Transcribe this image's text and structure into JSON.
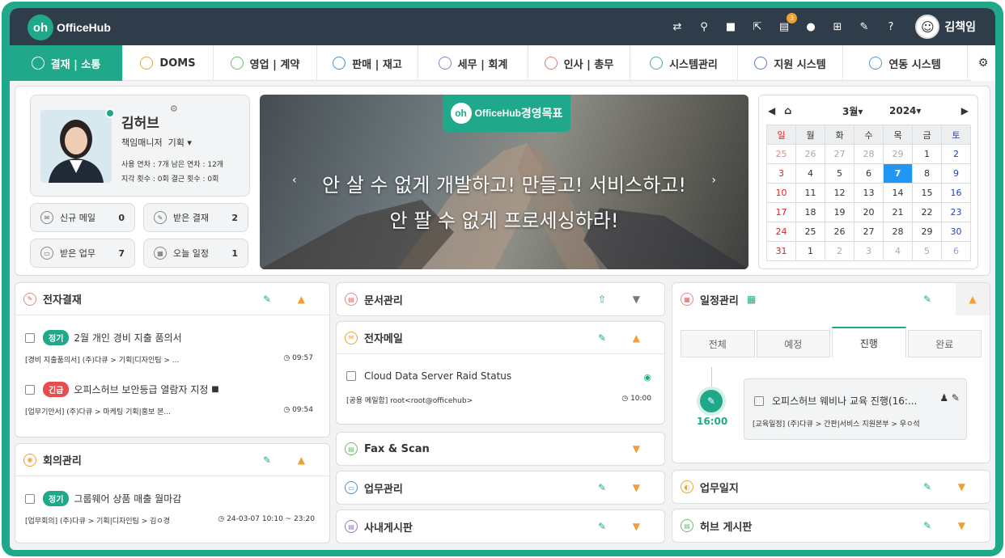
{
  "app": {
    "logo": "OfficeHub",
    "user": "김책임",
    "notif_badge": "3"
  },
  "nav": {
    "items": [
      {
        "label": "결재 | 소통",
        "icon": "chat-icon",
        "active": true,
        "w": 140
      },
      {
        "label": "DOMS",
        "icon": "doms-icon",
        "w": 112
      },
      {
        "label": "영업 | 계약",
        "icon": "handshake-icon",
        "w": 128
      },
      {
        "label": "판매 | 재고",
        "icon": "cart-icon",
        "w": 125
      },
      {
        "label": "세무 | 회계",
        "icon": "won-icon",
        "w": 136
      },
      {
        "label": "인사 | 총무",
        "icon": "person-icon",
        "w": 126
      },
      {
        "label": "시스템관리",
        "icon": "monitor-icon",
        "w": 133
      },
      {
        "label": "지원 시스템",
        "icon": "support-icon",
        "w": 130
      },
      {
        "label": "연동 시스템",
        "icon": "link-icon",
        "w": 154
      }
    ]
  },
  "profile": {
    "name": "김허브",
    "title": "책임매니저",
    "dept": "기획",
    "stats1": "사용 연차 : 7개  남은 연차 : 12개",
    "stats2": "지각 횟수 : 0회  결근 횟수 : 0회"
  },
  "quick": [
    {
      "label": "신규 메일",
      "count": "0"
    },
    {
      "label": "받은 결재",
      "count": "2"
    },
    {
      "label": "받은 업무",
      "count": "7"
    },
    {
      "label": "오늘 일정",
      "count": "1"
    }
  ],
  "banner": {
    "logo": "OfficeHub",
    "badge": "경영목표",
    "line1": "안 살 수 없게 개발하고! 만들고! 서비스하고!",
    "line2": "안 팔 수 없게 프로세싱하라!"
  },
  "calendar": {
    "month": "3월",
    "year": "2024",
    "weekdays": [
      "일",
      "월",
      "화",
      "수",
      "목",
      "금",
      "토"
    ],
    "days": [
      "25",
      "26",
      "27",
      "28",
      "29",
      "1",
      "2",
      "3",
      "4",
      "5",
      "6",
      "7",
      "8",
      "9",
      "10",
      "11",
      "12",
      "13",
      "14",
      "15",
      "16",
      "17",
      "18",
      "19",
      "20",
      "21",
      "22",
      "23",
      "24",
      "25",
      "26",
      "27",
      "28",
      "29",
      "30",
      "31",
      "1",
      "2",
      "3",
      "4",
      "5",
      "6"
    ],
    "today_index": 11,
    "muted_before": 5,
    "muted_after": 36
  },
  "approval": {
    "title": "전자결재",
    "items": [
      {
        "tag": "정기",
        "title": "2월 개인 경비 지출 품의서",
        "sub": "[경비 지출품의서] (주)다큐 > 기획|디자인팀 > ...",
        "time": "09:57"
      },
      {
        "tag": "긴급",
        "title": "오피스허브 보안등급 열람자 지정",
        "sub": "[업무기안서] (주)다큐 > 마케팅 기획|홍보 본...",
        "time": "09:54"
      }
    ]
  },
  "meeting": {
    "title": "회의관리",
    "item": {
      "tag": "정기",
      "title": "그룹웨어 상품 매출 월마감",
      "sub": "[업무회의] (주)다큐 > 기획|디자인팀 > 김ㅇ경",
      "time": "24-03-07 10:10 ~ 23:20"
    }
  },
  "docs": {
    "title": "문서관리"
  },
  "mail": {
    "title": "전자메일",
    "item": {
      "title": "Cloud Data Server Raid Status",
      "sub": "[공용 메일함] root<root@officehub>",
      "time": "10:00"
    }
  },
  "fax": {
    "title": "Fax & Scan"
  },
  "task": {
    "title": "업무관리"
  },
  "board": {
    "title": "사내게시판"
  },
  "schedule": {
    "title": "일정관리",
    "tabs": [
      "전체",
      "예정",
      "진행",
      "완료"
    ],
    "time": "16:00",
    "item": {
      "title": "오피스허브 웨비나 교육 진행(16:...",
      "sub": "[교육일정] (주)다큐 > 간판|서비스 지원본부 > 우ㅇ석"
    }
  },
  "log": {
    "title": "업무일지"
  },
  "hub": {
    "title": "허브 게시판"
  }
}
